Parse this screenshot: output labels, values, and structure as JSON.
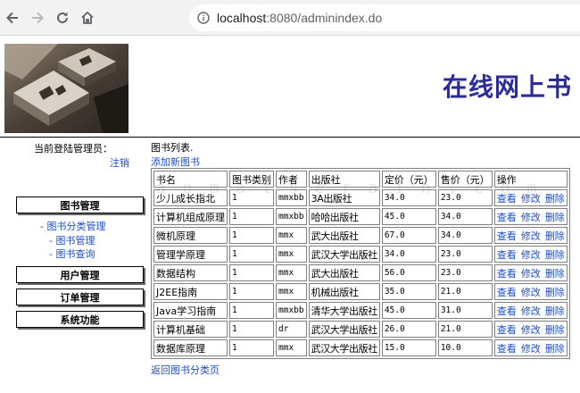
{
  "browser": {
    "url_host": "localhost",
    "url_path": ":8080/adminindex.do",
    "icons": [
      "back-arrow-icon",
      "forward-arrow-icon",
      "reload-icon",
      "home-icon",
      "info-icon"
    ]
  },
  "banner": {
    "title": "在线网上书"
  },
  "sidebar": {
    "admin_label": "当前登陆管理员：",
    "logout": "注销",
    "menus": {
      "book": "图书管理",
      "user": "用户管理",
      "order": "订单管理",
      "system": "系统功能"
    },
    "sublinks": {
      "category": "图书分类管理",
      "manage": "图书管理",
      "query": "图书查询"
    }
  },
  "main": {
    "list_title": "图书列表.",
    "add_link": "添加新图书",
    "back_link": "返回图书分类页",
    "columns": [
      "书名",
      "图书类别",
      "作者",
      "出版社",
      "定价（元）",
      "售价（元）",
      "操作"
    ],
    "actions": [
      "查看",
      "修改",
      "删除"
    ],
    "rows": [
      {
        "name": "少儿成长指北",
        "category": "1",
        "author": "mmxbb",
        "publisher": "3A出版社",
        "price": "34.0",
        "sale": "23.0"
      },
      {
        "name": "计算机组成原理",
        "category": "1",
        "author": "mmxbb",
        "publisher": "哈哈出版社",
        "price": "45.0",
        "sale": "34.0"
      },
      {
        "name": "微机原理",
        "category": "1",
        "author": "mmx",
        "publisher": "武大出版社",
        "price": "67.0",
        "sale": "34.0"
      },
      {
        "name": "管理学原理",
        "category": "1",
        "author": "mmx",
        "publisher": "武汉大学出版社",
        "price": "34.0",
        "sale": "23.0"
      },
      {
        "name": "数据结构",
        "category": "1",
        "author": "mmx",
        "publisher": "武大出版社",
        "price": "56.0",
        "sale": "23.0"
      },
      {
        "name": "J2EE指南",
        "category": "1",
        "author": "mmx",
        "publisher": "机械出版社",
        "price": "35.0",
        "sale": "21.0"
      },
      {
        "name": "Java学习指南",
        "category": "1",
        "author": "mmxbb",
        "publisher": "清华大学出版社",
        "price": "45.0",
        "sale": "31.0"
      },
      {
        "name": "计算机基础",
        "category": "1",
        "author": "dr",
        "publisher": "武汉大学出版社",
        "price": "26.0",
        "sale": "21.0"
      },
      {
        "name": "数据库原理",
        "category": "1",
        "author": "mmx",
        "publisher": "武汉大学出版社",
        "price": "15.0",
        "sale": "10.0"
      }
    ]
  },
  "watermark": "a  o m a t s e  r a i n . c o m",
  "colors": {
    "link": "#1a4dcc",
    "title": "#2b2b9a",
    "chrome": "#f2f2f2"
  }
}
